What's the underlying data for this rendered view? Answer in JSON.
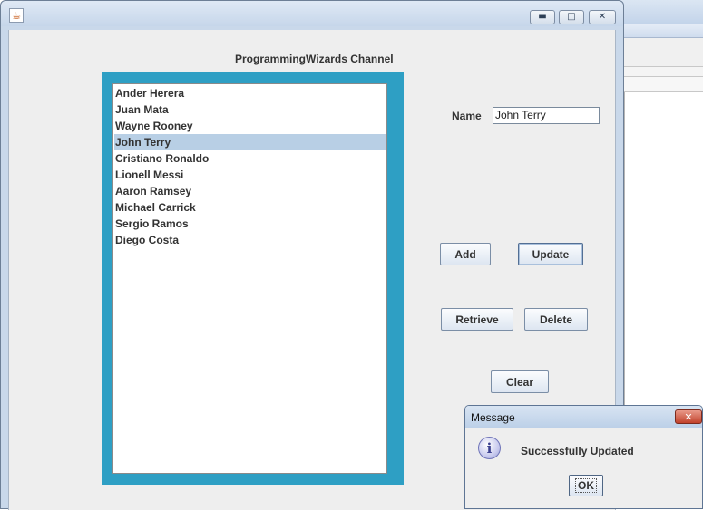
{
  "window": {
    "icon": "java-cup-icon",
    "controls": {
      "minimize": "minimize-icon",
      "maximize": "maximize-icon",
      "close": "close-icon"
    }
  },
  "channel_title": "ProgrammingWizards Channel",
  "list": {
    "items": [
      "Ander Herera",
      "Juan Mata",
      "Wayne Rooney",
      "John Terry",
      "Cristiano Ronaldo",
      "Lionell Messi",
      "Aaron Ramsey",
      "Michael Carrick",
      "Sergio Ramos",
      "Diego Costa"
    ],
    "selected": "John Terry",
    "frame_color": "#2e9fc4",
    "selection_color": "#b8cfe5"
  },
  "form": {
    "name_label": "Name",
    "name_value": "John Terry"
  },
  "buttons": {
    "add": "Add",
    "update": "Update",
    "retrieve": "Retrieve",
    "delete": "Delete",
    "clear": "Clear"
  },
  "dialog": {
    "title": "Message",
    "close_icon": "close-icon",
    "icon": "info-icon",
    "message": "Successfully Updated",
    "ok": "OK"
  }
}
